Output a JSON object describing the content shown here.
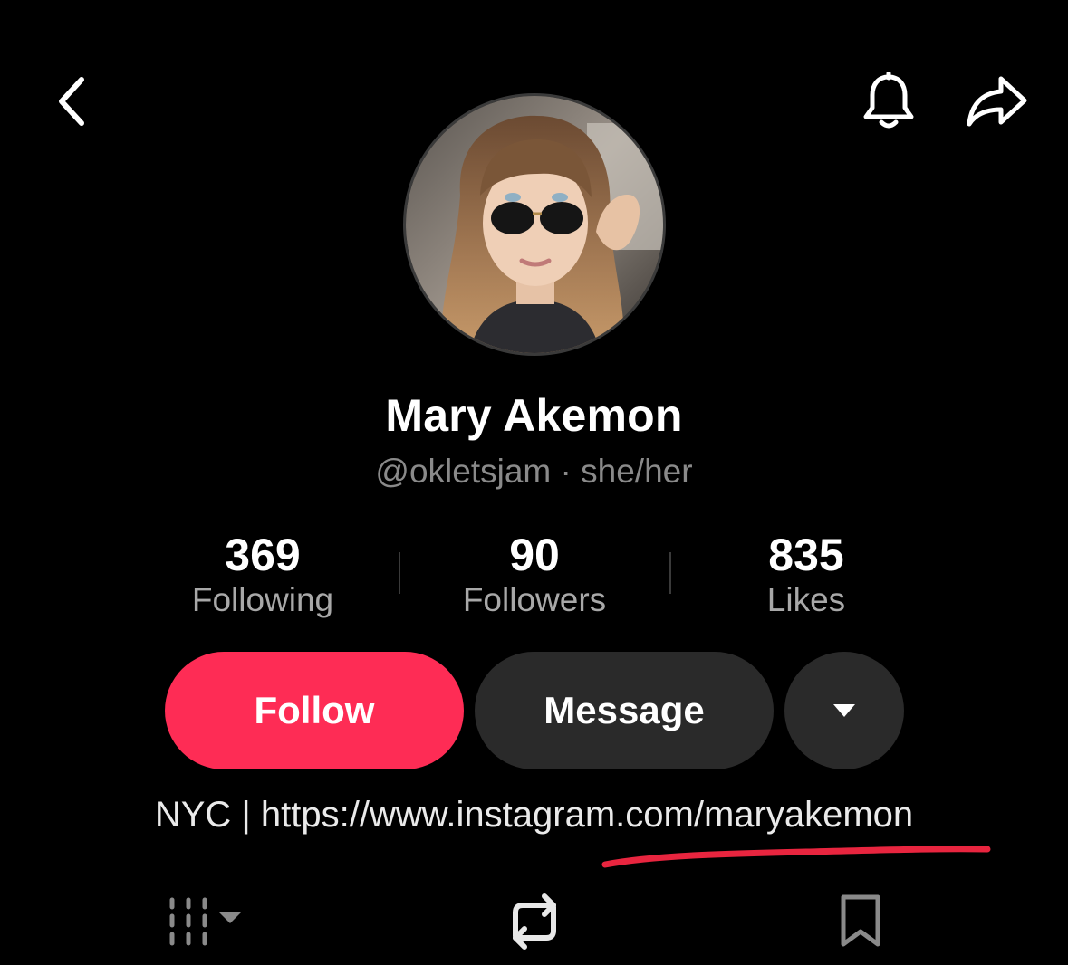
{
  "header": {
    "back_icon": "chevron-left-icon",
    "bell_icon": "bell-icon",
    "share_icon": "share-arrow-icon"
  },
  "profile": {
    "display_name": "Mary Akemon",
    "handle_line": "@okletsjam · she/her"
  },
  "stats": [
    {
      "value": "369",
      "label": "Following"
    },
    {
      "value": "90",
      "label": "Followers"
    },
    {
      "value": "835",
      "label": "Likes"
    }
  ],
  "actions": {
    "follow_label": "Follow",
    "message_label": "Message",
    "more_icon": "caret-down-icon"
  },
  "bio": {
    "prefix": "NYC | ",
    "link_text": "https://www.instagram.com/maryakemon"
  },
  "tabs": [
    {
      "icon": "grid-videos-icon"
    },
    {
      "icon": "repost-icon"
    },
    {
      "icon": "bookmark-icon"
    }
  ],
  "colors": {
    "background": "#000000",
    "follow_button": "#fe2c55",
    "secondary_button": "#2a2a2a",
    "annotation_underline": "#e8253f"
  }
}
